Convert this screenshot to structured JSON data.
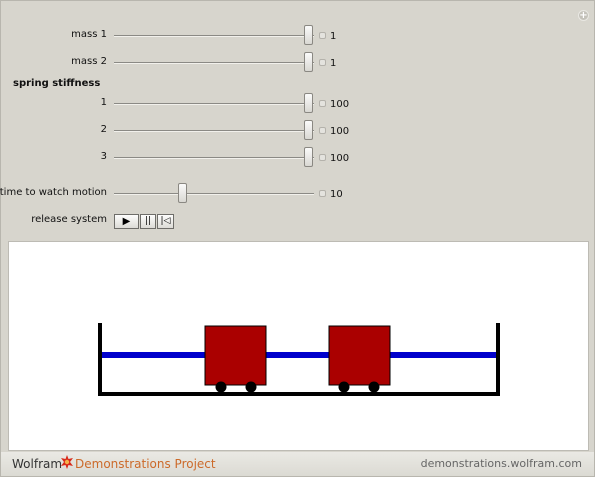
{
  "controls": {
    "mass1": {
      "label": "mass 1",
      "value": "1",
      "level": 1.0
    },
    "mass2": {
      "label": "mass 2",
      "value": "1",
      "level": 1.0
    },
    "spring_title": "spring  stiffness",
    "spring1": {
      "label": "1",
      "value": "100",
      "level": 1.0
    },
    "spring2": {
      "label": "2",
      "value": "100",
      "level": 1.0
    },
    "spring3": {
      "label": "3",
      "value": "100",
      "level": 1.0
    },
    "time": {
      "label": "time to watch motion",
      "value": "10",
      "level": 0.35
    },
    "release": {
      "label": "release system",
      "play": "▶",
      "pause": "||",
      "reset": "|◁"
    }
  },
  "footer": {
    "brand": "Wolfram",
    "project": "Demonstrations Project",
    "url": "demonstrations.wolfram.com"
  },
  "colors": {
    "spring": "#0000cc",
    "mass": "#aa0000",
    "wall": "#000000"
  },
  "icons": [
    "plus-icon",
    "play-icon",
    "pause-icon",
    "reset-icon",
    "wolfram-spikey-icon"
  ]
}
